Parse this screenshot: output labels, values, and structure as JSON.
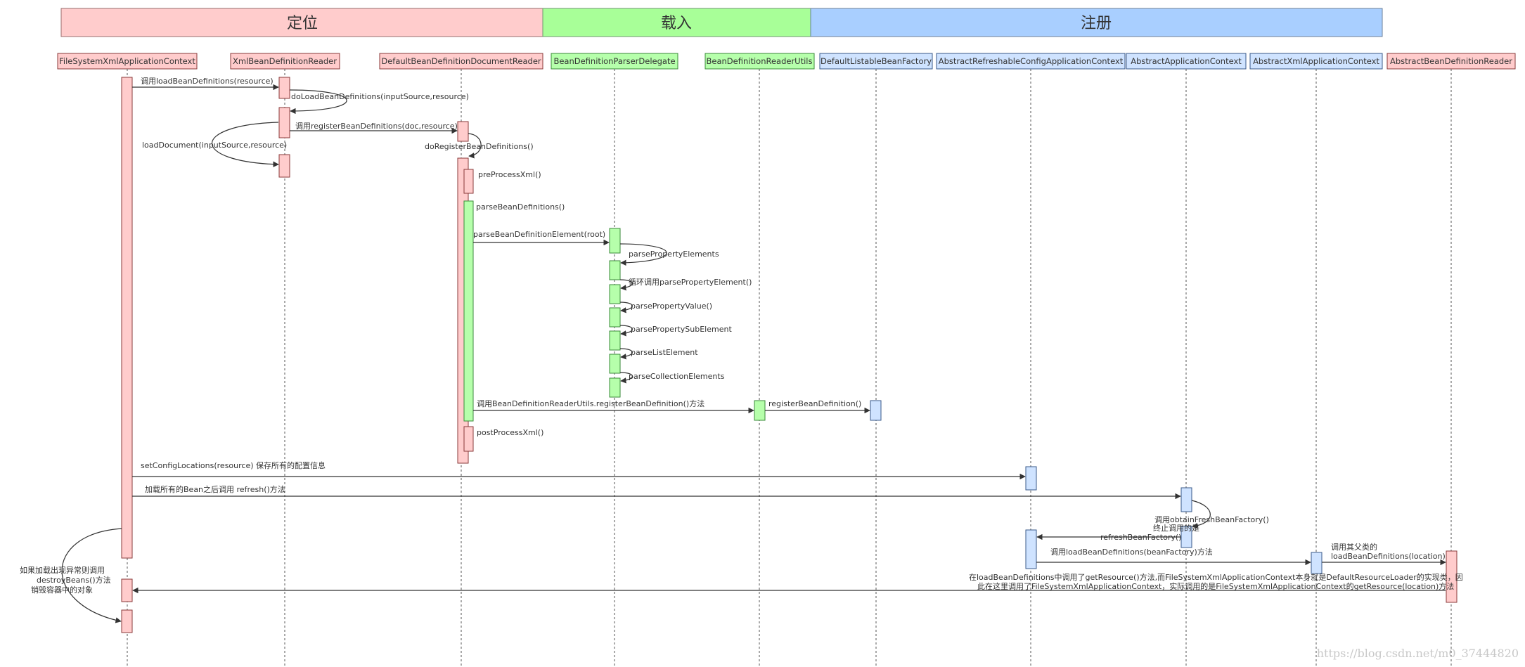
{
  "phases": [
    {
      "label": "定位",
      "color": "#ffcccc"
    },
    {
      "label": "载入",
      "color": "#a8ff98"
    },
    {
      "label": "注册",
      "color": "#a9cfff"
    }
  ],
  "participants": [
    {
      "label": "FileSystemXmlApplicationContext",
      "color": "#ffcccc"
    },
    {
      "label": "XmlBeanDefinitionReader",
      "color": "#ffcccc"
    },
    {
      "label": "DefaultBeanDefinitionDocumentReader",
      "color": "#ffcccc"
    },
    {
      "label": "BeanDefinitionParserDelegate",
      "color": "#b6ffab"
    },
    {
      "label": "BeanDefinitionReaderUtils",
      "color": "#b6ffab"
    },
    {
      "label": "DefaultListableBeanFactory",
      "color": "#cfe3ff"
    },
    {
      "label": "AbstractRefreshableConfigApplicationContext",
      "color": "#cfe3ff"
    },
    {
      "label": "AbstractApplicationContext",
      "color": "#cfe3ff"
    },
    {
      "label": "AbstractXmlApplicationContext",
      "color": "#cfe3ff"
    },
    {
      "label": "AbstractBeanDefinitionReader",
      "color": "#ffcccc"
    }
  ],
  "messages": {
    "m1": "调用loadBeanDefinitions(resource)",
    "m2": "doLoadBeanDefinitions(inputSource,resource)",
    "m3": "loadDocument(inputSource,resource)",
    "m4": "调用registerBeanDefinitions(doc,resource)",
    "m5": "doRegisterBeanDefinitions()",
    "m6": "preProcessXml()",
    "m7": "parseBeanDefinitions()",
    "m8": "parseBeanDefinitionElement(root)",
    "m9": "parsePropertyElements",
    "m10": "循环调用parsePropertyElement()",
    "m11": "parsePropertyValue()",
    "m12": "parsePropertySubElement",
    "m13": "parseListElement",
    "m14": "parseCollectionElements",
    "m15": "调用BeanDefinitionReaderUtils.registerBeanDefinition()方法",
    "m16": "registerBeanDefinition()",
    "m17": "postProcessXml()",
    "m18": "setConfigLocations(resource)  保存所有的配置信息",
    "m19": "加载所有的Bean之后调用 refresh()方法",
    "m20": "调用obtainFreshBeanFactory()",
    "m21a": "终止调用的是",
    "m21b": "refreshBeanFactory()",
    "m22": "调用loadBeanDefinitions(beanFactory)方法",
    "m23a": "调用其父类的",
    "m23b": "loadBeanDefinitions(location)",
    "m24a": "在loadBeanDefinitions中调用了getResource()方法,而FileSystemXmlApplicationContext本身就是DefaultResourceLoader的实现类，因",
    "m24b": "此在这里调用了FileSystemXmlApplicationContext，实际调用的是FileSystemXmlApplicationContext的getResource(location)方法",
    "m25a": "如果加载出现异常则调用",
    "m25b": "destroyBeans()方法",
    "m25c": "销毁容器中的对象"
  },
  "watermark": "https://blog.csdn.net/m0_37444820",
  "colors": {
    "pink": "#ffcccc",
    "green": "#b6ffab",
    "blue": "#cfe3ff",
    "border": "#8a3a3a",
    "line": "#333333"
  }
}
